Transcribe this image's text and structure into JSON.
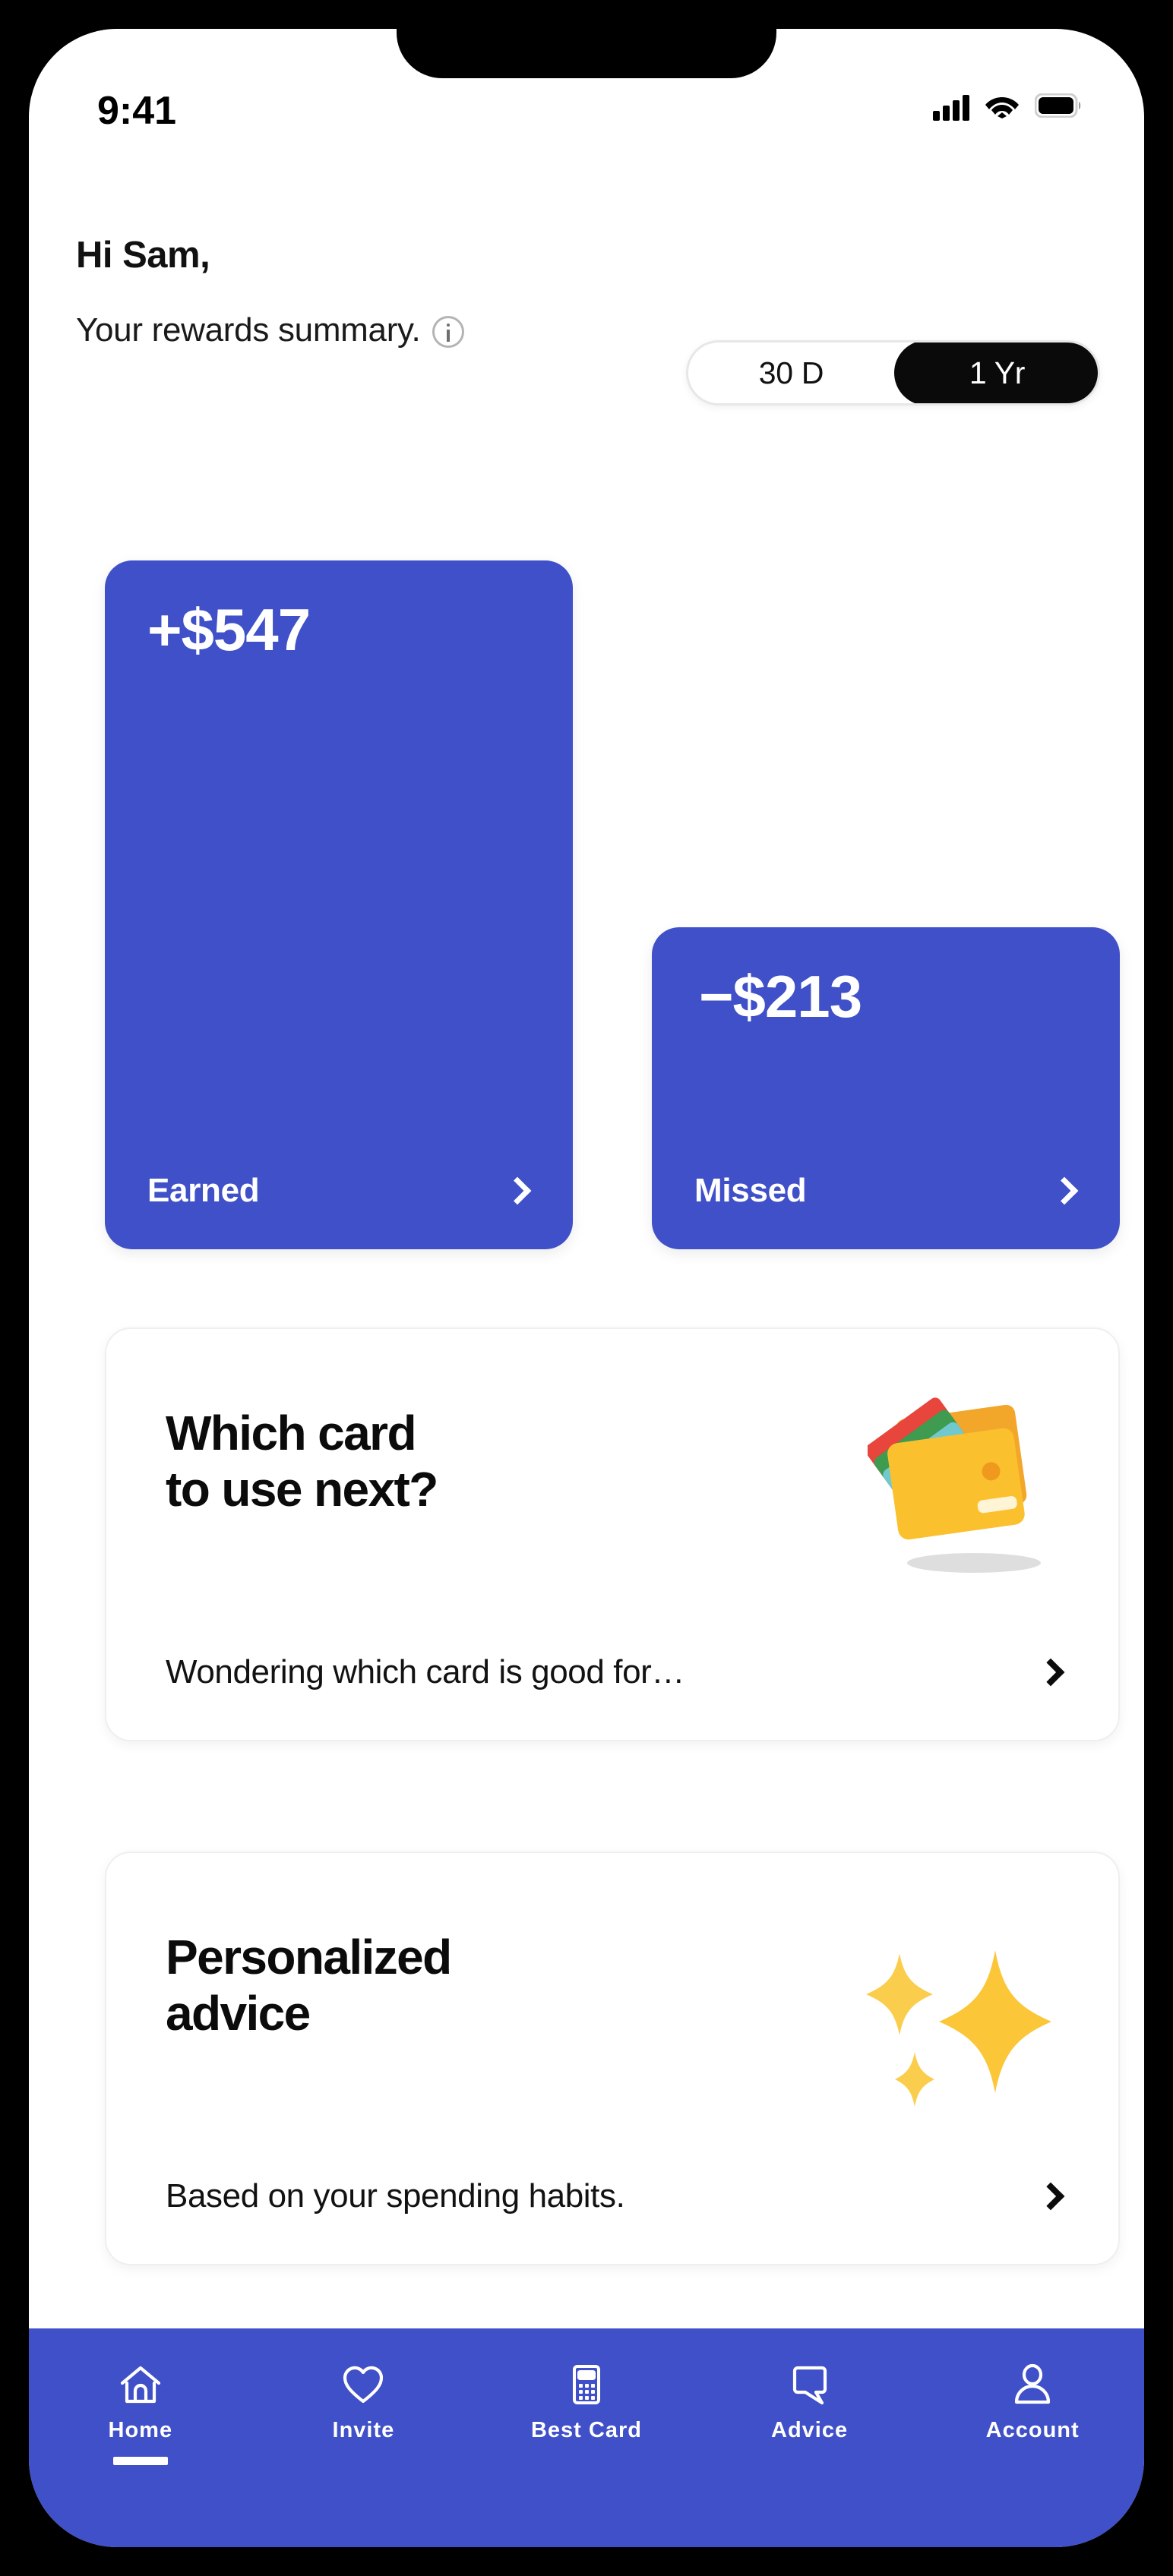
{
  "status_bar": {
    "time": "9:41",
    "icons": [
      "cellular-signal-icon",
      "wifi-icon",
      "battery-icon"
    ]
  },
  "header": {
    "greeting": "Hi Sam,",
    "subtitle": "Your rewards summary.",
    "info_icon": "info-circle-icon"
  },
  "range_toggle": {
    "options": [
      {
        "label": "30 D",
        "selected": false
      },
      {
        "label": "1 Yr",
        "selected": true
      }
    ],
    "selected_bg": "#0a0a0a",
    "selected_fg": "#ffffff"
  },
  "summary": {
    "accent_color": "#3f50c8",
    "cards": [
      {
        "amount": "+$547",
        "label": "Earned",
        "chevron": "chevron-right-icon"
      },
      {
        "amount": "−$213",
        "label": "Missed",
        "chevron": "chevron-right-icon"
      }
    ]
  },
  "features": [
    {
      "title_line1": "Which card",
      "title_line2": "to use next?",
      "subtitle": "Wondering which card is good for…",
      "art": "wallet-illustration",
      "chevron": "chevron-right-icon"
    },
    {
      "title_line1": "Personalized",
      "title_line2": "advice",
      "subtitle": "Based on your spending habits.",
      "art": "sparkles-illustration",
      "chevron": "chevron-right-icon"
    }
  ],
  "bottom_nav": {
    "background": "#3f50c8",
    "items": [
      {
        "label": "Home",
        "icon": "home-icon",
        "active": true
      },
      {
        "label": "Invite",
        "icon": "heart-icon",
        "active": false
      },
      {
        "label": "Best Card",
        "icon": "calculator-icon",
        "active": false
      },
      {
        "label": "Advice",
        "icon": "speech-bubble-icon",
        "active": false
      },
      {
        "label": "Account",
        "icon": "person-icon",
        "active": false
      }
    ]
  }
}
